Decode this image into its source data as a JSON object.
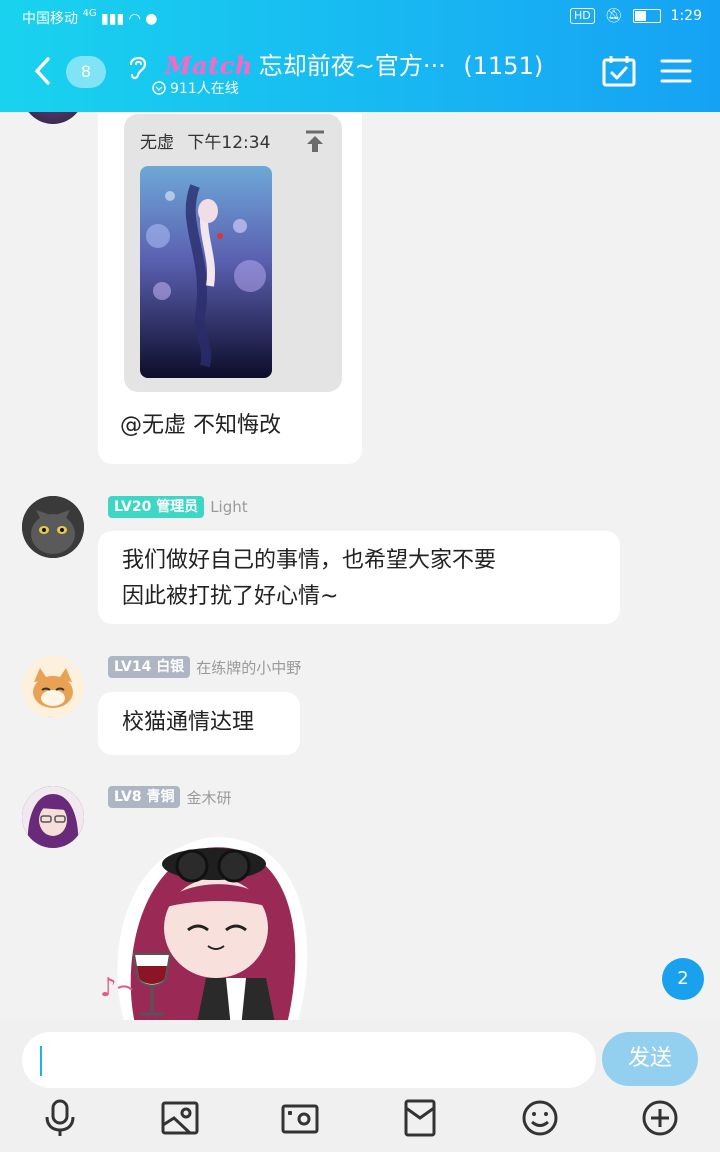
{
  "status_bar": {
    "carrier": "中国移动",
    "network": "4G",
    "time": "1:29",
    "hd": "HD"
  },
  "header": {
    "back_count": "8",
    "logo": "Match",
    "title": "忘却前夜~官方···",
    "member_count": "(1151)",
    "online": "911人在线"
  },
  "messages": [
    {
      "quote_name": "无虚",
      "quote_time": "下午12:34",
      "text": "@无虚 不知悔改"
    },
    {
      "level": "LV20",
      "role": "管理员",
      "name": "Light",
      "text_line1": "我们做好自己的事情，也希望大家不要",
      "text_line2": "因此被打扰了好心情~"
    },
    {
      "level": "LV14",
      "role": "白银",
      "name": "在练牌的小中野",
      "text": "校猫通情达理"
    },
    {
      "level": "LV8",
      "role": "青铜",
      "name": "金木研",
      "sticker": "wine-sticker"
    }
  ],
  "unread_count": "2",
  "input": {
    "send_label": "发送"
  },
  "colors": {
    "header_start": "#19d3ee",
    "header_end": "#16a2f4",
    "admin_badge": "#3ed6c4",
    "level_badge": "#aeb6c4",
    "send_button": "#93cfee",
    "unread_badge": "#1aa1ee"
  }
}
